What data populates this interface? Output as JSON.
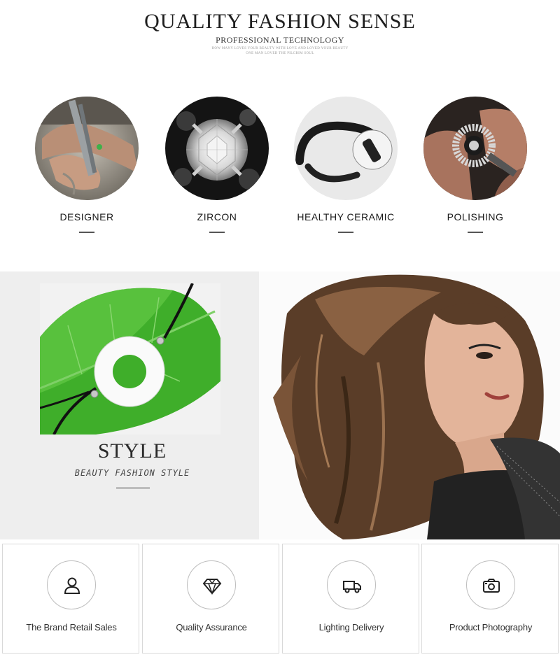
{
  "header": {
    "title": "QUALITY FASHION SENSE",
    "subtitle": "PROFESSIONAL TECHNOLOGY",
    "tiny_line1": "HOW MANY LOVES YOUR BEAUTY WITH LOVE AND LOVED YOUR BEAUTY",
    "tiny_line2": "ONE MAN LOVED THE PILGRIM SOUL"
  },
  "features": [
    {
      "label": "DESIGNER",
      "icon": "designer-tools-photo"
    },
    {
      "label": "ZIRCON",
      "icon": "zircon-gem-photo"
    },
    {
      "label": "HEALTHY CERAMIC",
      "icon": "ceramic-cuff-photo"
    },
    {
      "label": "POLISHING",
      "icon": "polishing-ring-photo"
    }
  ],
  "style_section": {
    "title": "STYLE",
    "subtitle": "BEAUTY FASHION STYLE"
  },
  "services": [
    {
      "label": "The Brand Retail Sales",
      "icon": "user-icon"
    },
    {
      "label": "Quality Assurance",
      "icon": "diamond-icon"
    },
    {
      "label": "Lighting Delivery",
      "icon": "truck-icon"
    },
    {
      "label": "Product Photography",
      "icon": "camera-icon"
    }
  ],
  "colors": {
    "panel_bg": "#eeeeee",
    "leaf_green": "#3fae2a",
    "text_dark": "#1e1e1e",
    "border": "#d9d9d9"
  }
}
